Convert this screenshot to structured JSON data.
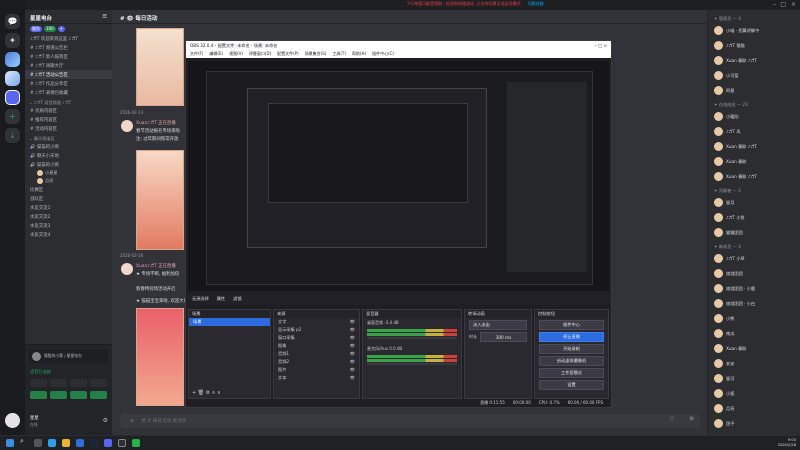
{
  "topbar": {
    "notice": "下行带宽可能受限制 · 检测到网络波动, 已为你切换至低延迟模式",
    "notice_action": "切换线路"
  },
  "server": {
    "name": "星星电台",
    "tags": [
      "服务",
      "100",
      "✦"
    ]
  },
  "channels": [
    {
      "label": "♪♬T 欢迎来到这里 ♪♬T",
      "selected": false
    },
    {
      "label": "# ♪♬T 频道公告栏",
      "selected": false
    },
    {
      "label": "# ♪♬T 新人报到区",
      "selected": false
    },
    {
      "label": "# ♪♬T 闲聊大厅",
      "selected": false
    },
    {
      "label": "# ♪♬T 活动公告区",
      "selected": true
    },
    {
      "label": "# ♪♬T 作品分享区",
      "selected": false
    },
    {
      "label": "# ♪♬T 表情包收藏",
      "selected": false
    }
  ],
  "categories": [
    {
      "label": "⌄ ♪♬T 语音频道 ♪♬T"
    },
    {
      "label": "# 优质内容区"
    },
    {
      "label": "# 推荐内容区"
    },
    {
      "label": "# 活动内容区"
    },
    {
      "label": "⌄ 聊天频道区"
    }
  ],
  "voice": [
    {
      "label": "🔊 猫猫的小窝"
    },
    {
      "label": "🔊 聊天小天地"
    },
    {
      "label": "🔊 猫猫的小窝"
    }
  ],
  "voice_users": [
    {
      "name": "小星星"
    },
    {
      "name": "月亮"
    }
  ],
  "voice_more": [
    "比赛区",
    "战队区",
    "水友交流1",
    "水友交流2",
    "水友交流3",
    "水友交流4"
  ],
  "voicebox": {
    "status": "语音已连接",
    "channel": "猫猫的小窝 / 星星电台"
  },
  "user": {
    "name": "星星",
    "status": "在线"
  },
  "chat": {
    "channel_title": "# 👁 每日活动",
    "date1": "2026-02-13",
    "author": "Xuan♪♬T 正在直播",
    "msg1": "春节活动报名专场来啦",
    "msg2": "注: 过年期间照常开放",
    "date2": "2026-02-16",
    "author2": "Xuan♪♬T 正在直播",
    "msg3": "★ 专场不断, 福利加倍",
    "msg4": "新春特别场活动开启",
    "msg5": "★ 猫猫宝宝来啦, 欢迎大家",
    "composer_placeholder": "给 # 每日活动 发消息"
  },
  "obs": {
    "title": "OBS 32.0.4 - 配置文件: 未命名 - 场景: 未命名",
    "menus": [
      "文件(F)",
      "编辑(E)",
      "视图(V)",
      "停靠窗口(D)",
      "配置文件(P)",
      "场景集合(S)",
      "工具(T)",
      "帮助(H)",
      "插件中心(C)"
    ],
    "tabs": [
      "无源选择",
      "属性",
      "滤镜"
    ],
    "docks": {
      "scenes": {
        "title": "场景",
        "items": [
          "场景"
        ]
      },
      "sources": {
        "title": "来源",
        "items": [
          "文字",
          "显示采集 p2",
          "窗口采集",
          "图像",
          "音频1",
          "音频2",
          "图片",
          "文本"
        ]
      },
      "mixer": {
        "title": "混音器",
        "tracks": [
          "桌面音频 -3.4 dB",
          "麦克风/Aux 0.0 dB"
        ]
      },
      "transitions": {
        "title": "转场动画",
        "type": "淡入淡出",
        "duration_label": "时长",
        "duration": "300 ms"
      },
      "controls": {
        "title": "控制按钮",
        "buttons": [
          "插件中心",
          "停止直播",
          "开始录制",
          "启动虚拟摄像机",
          "工作室模式",
          "设置",
          "退出"
        ]
      }
    },
    "status": [
      "直播 0:11:55",
      "00:00:00",
      "CPU: 0.7%",
      "60.00 / 60.00 FPS"
    ]
  },
  "members": {
    "groups": [
      {
        "label": "✦ 管理员 — 4"
      },
      {
        "label": "✦ 在线成员 — 23"
      },
      {
        "label": "✦ 贡献者 — 2"
      },
      {
        "label": "✦ 新成员 — 4"
      }
    ],
    "rows": [
      "小喵 · 招募讲解中",
      "♪♬T 猫猫",
      "Xuan 春联 ♪♬T",
      "小可爱",
      "阿星",
      "小暖阳",
      "♪♬T 风",
      "Xuan 春联 ♪♬T",
      "Xuan 春联",
      "Xuan 春联 ♪♬T",
      "星月",
      "♪♬T 小鱼",
      "猫猫团团",
      "♪♬T 小草",
      "旅游团团",
      "旅游团团 · 小鹿",
      "旅游团团 · 小白",
      "小熊",
      "南瓜",
      "Xuan 春联",
      "安安",
      "星河",
      "小狐",
      "月亮",
      "团子"
    ]
  },
  "taskbar": {
    "time": "9:03",
    "date": "2026/2/28"
  }
}
